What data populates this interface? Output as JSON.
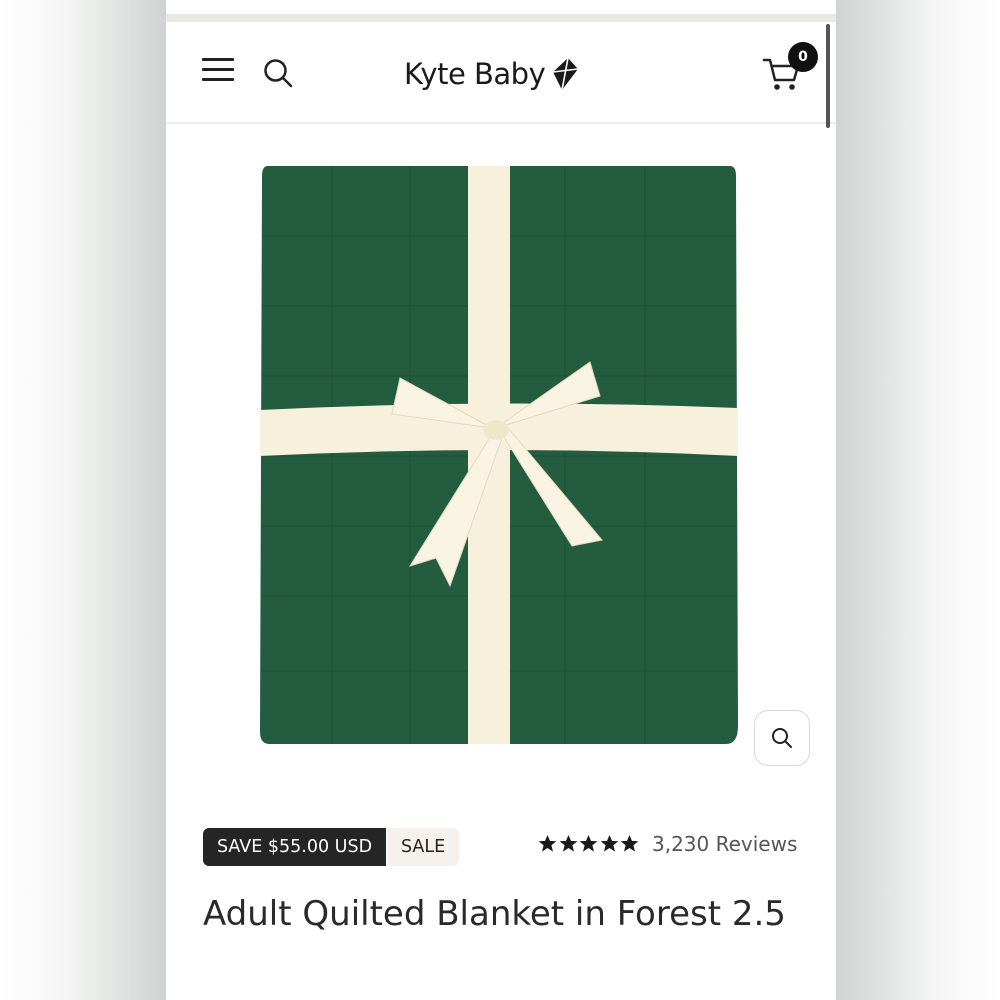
{
  "header": {
    "brand_name": "Kyte Baby",
    "cart_count": "0"
  },
  "product": {
    "save_label": "SAVE $55.00 USD",
    "sale_label": "SALE",
    "rating_stars": 5,
    "reviews_label": "3,230 Reviews",
    "title": "Adult Quilted Blanket in Forest 2.5"
  },
  "icons": [
    "menu-icon",
    "search-icon",
    "kite-logo-icon",
    "cart-icon",
    "zoom-icon",
    "star-icon"
  ],
  "colors": {
    "blanket_green": "#235c3e",
    "ribbon_cream": "#f6f0dc",
    "badge_dark": "#252525",
    "sale_bg": "#f6f1ec"
  }
}
